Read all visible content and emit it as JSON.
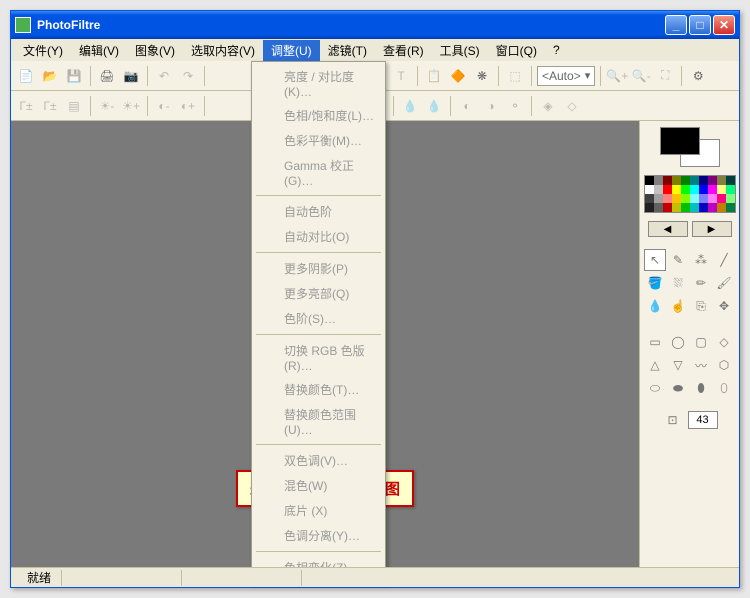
{
  "title": "PhotoFiltre",
  "menubar": [
    {
      "label": "文件(Y)"
    },
    {
      "label": "编辑(V)"
    },
    {
      "label": "图象(V)"
    },
    {
      "label": "选取内容(V)"
    },
    {
      "label": "调整(U)",
      "active": true
    },
    {
      "label": "滤镜(T)"
    },
    {
      "label": "查看(R)"
    },
    {
      "label": "工具(S)"
    },
    {
      "label": "窗口(Q)"
    },
    {
      "label": "?"
    }
  ],
  "toolbar1": {
    "auto_combo": "<Auto>"
  },
  "toolbar2": {},
  "dropdown": {
    "groups": [
      [
        "亮度 / 对比度(K)…",
        "色相/饱和度(L)…",
        "色彩平衡(M)…",
        "Gamma 校正(G)…"
      ],
      [
        "自动色阶",
        "自动对比(O)"
      ],
      [
        "更多阴影(P)",
        "更多亮部(Q)",
        "色阶(S)…"
      ],
      [
        "切换 RGB 色版(R)…",
        "替换颜色(T)…",
        "替换颜色范围(U)…"
      ],
      [
        "双色调(V)…",
        "混色(W)",
        "底片 (X)",
        "色调分离(Y)…"
      ],
      [
        "色相变化(Z)…"
      ]
    ]
  },
  "caption": "未加载图像时的界面图",
  "statusbar": {
    "ready": "就绪"
  },
  "sidebar": {
    "fg_color": "#000000",
    "bg_color": "#ffffff",
    "palette": [
      "#000000",
      "#808080",
      "#800000",
      "#808000",
      "#008000",
      "#008080",
      "#000080",
      "#800080",
      "#808040",
      "#004040",
      "#ffffff",
      "#c0c0c0",
      "#ff0000",
      "#ffff00",
      "#00ff00",
      "#00ffff",
      "#0000ff",
      "#ff00ff",
      "#ffff80",
      "#00ff80",
      "#404040",
      "#a0a0a0",
      "#ff8080",
      "#ffc000",
      "#80ff00",
      "#80ffff",
      "#8080ff",
      "#ff80ff",
      "#ff0080",
      "#80ff80",
      "#202020",
      "#606060",
      "#c00000",
      "#c0c000",
      "#00c000",
      "#00c0c0",
      "#0000c0",
      "#c000c0",
      "#c08000",
      "#008040"
    ],
    "shape_size": "43"
  }
}
